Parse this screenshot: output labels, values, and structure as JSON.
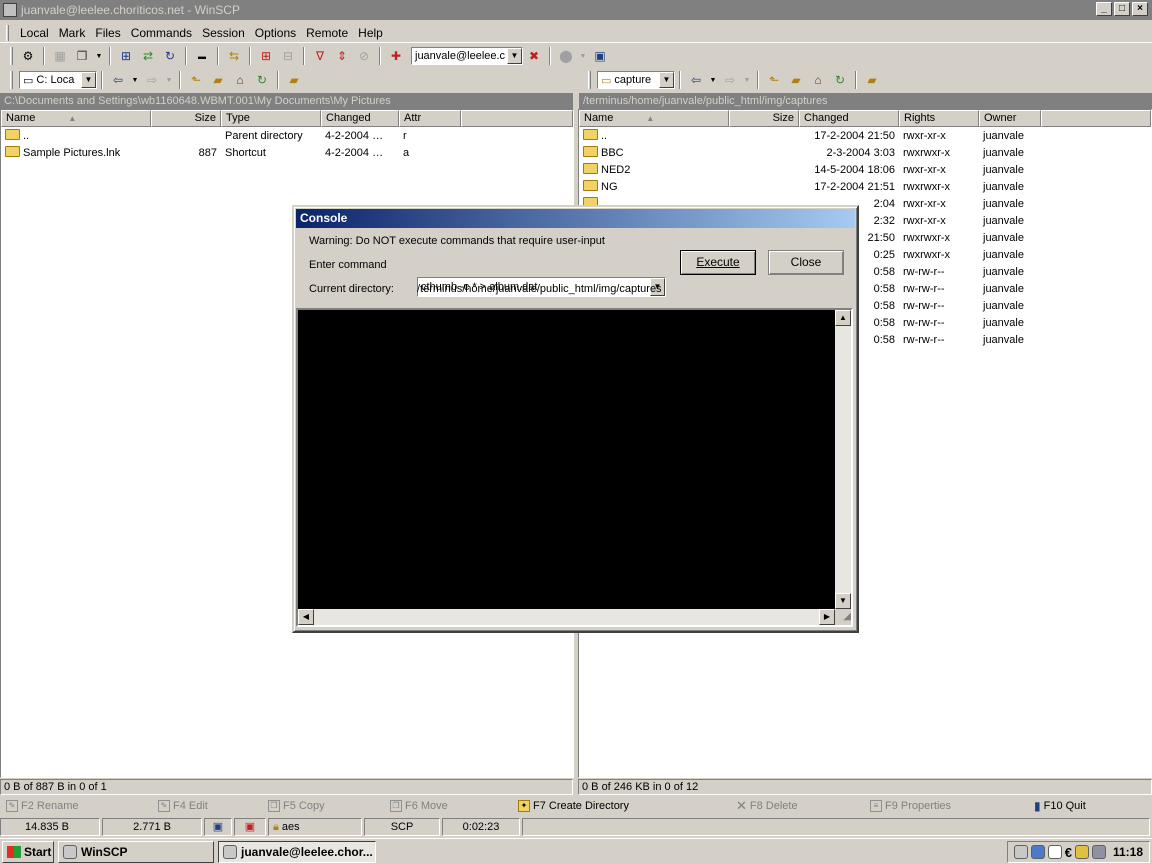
{
  "window": {
    "title": "juanvale@leelee.choriticos.net - WinSCP"
  },
  "menu": [
    "Local",
    "Mark",
    "Files",
    "Commands",
    "Session",
    "Options",
    "Remote",
    "Help"
  ],
  "toolbar": {
    "session_combo": "juanvale@leelee.c"
  },
  "left": {
    "drive": "C: Loca",
    "path": "C:\\Documents and Settings\\wb1160648.WBMT.001\\My Documents\\My Pictures",
    "columns": [
      "Name",
      "Size",
      "Type",
      "Changed",
      "Attr"
    ],
    "rows": [
      {
        "name": "..",
        "size": "",
        "type": "Parent directory",
        "changed": "4-2-2004  …",
        "attr": "r"
      },
      {
        "name": "Sample Pictures.lnk",
        "size": "887",
        "type": "Shortcut",
        "changed": "4-2-2004  …",
        "attr": "a"
      }
    ],
    "status": "0 B of 887 B in 0 of 1"
  },
  "right": {
    "dir": "capture",
    "path": "/terminus/home/juanvale/public_html/img/captures",
    "columns": [
      "Name",
      "Size",
      "Changed",
      "Rights",
      "Owner"
    ],
    "rows": [
      {
        "name": "..",
        "changed": "17-2-2004 21:50",
        "rights": "rwxr-xr-x",
        "owner": "juanvale"
      },
      {
        "name": "BBC",
        "changed": "2-3-2004 3:03",
        "rights": "rwxrwxr-x",
        "owner": "juanvale"
      },
      {
        "name": "NED2",
        "changed": "14-5-2004 18:06",
        "rights": "rwxr-xr-x",
        "owner": "juanvale"
      },
      {
        "name": "NG",
        "changed": "17-2-2004 21:51",
        "rights": "rwxrwxr-x",
        "owner": "juanvale"
      },
      {
        "name": "",
        "changed": "2:04",
        "rights": "rwxr-xr-x",
        "owner": "juanvale"
      },
      {
        "name": "",
        "changed": "2:32",
        "rights": "rwxr-xr-x",
        "owner": "juanvale"
      },
      {
        "name": "",
        "changed": "21:50",
        "rights": "rwxrwxr-x",
        "owner": "juanvale"
      },
      {
        "name": "",
        "changed": "0:25",
        "rights": "rwxrwxr-x",
        "owner": "juanvale"
      },
      {
        "name": "",
        "changed": "0:58",
        "rights": "rw-rw-r--",
        "owner": "juanvale"
      },
      {
        "name": "",
        "changed": "0:58",
        "rights": "rw-rw-r--",
        "owner": "juanvale"
      },
      {
        "name": "",
        "changed": "0:58",
        "rights": "rw-rw-r--",
        "owner": "juanvale"
      },
      {
        "name": "",
        "changed": "0:58",
        "rights": "rw-rw-r--",
        "owner": "juanvale"
      },
      {
        "name": "",
        "changed": "0:58",
        "rights": "rw-rw-r--",
        "owner": "juanvale"
      }
    ],
    "status": "0 B of 246 KB in 0 of 12"
  },
  "console": {
    "title": "Console",
    "warning": "Warning: Do NOT execute commands that require user-input",
    "command_label": "Enter command",
    "command_value": "cthumb -c * > album.dat",
    "execute_label": "Execute",
    "close_label": "Close",
    "dir_label": "Current directory:",
    "dir_value": "/terminus/home/juanvale/public_html/img/captures"
  },
  "fkeys": [
    {
      "label": "F2 Rename",
      "active": false
    },
    {
      "label": "F4 Edit",
      "active": false
    },
    {
      "label": "F5 Copy",
      "active": false
    },
    {
      "label": "F6 Move",
      "active": false
    },
    {
      "label": "F7 Create Directory",
      "active": true
    },
    {
      "label": "F8 Delete",
      "active": false
    },
    {
      "label": "F9 Properties",
      "active": false
    },
    {
      "label": "F10 Quit",
      "active": true
    }
  ],
  "statusbar": {
    "bytes_up": "14.835 B",
    "bytes_down": "2.771 B",
    "cipher": "aes",
    "protocol": "SCP",
    "elapsed": "0:02:23"
  },
  "taskbar": {
    "start": "Start",
    "tasks": [
      "WinSCP",
      "juanvale@leelee.chor..."
    ],
    "clock": "11:18"
  }
}
